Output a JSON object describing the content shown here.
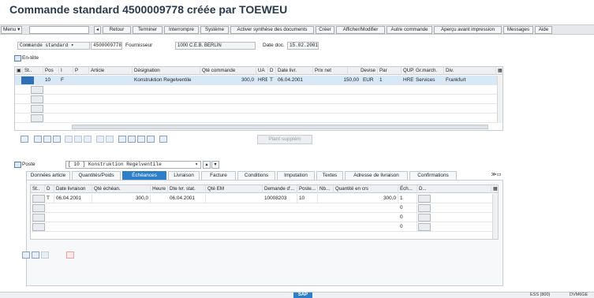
{
  "window": {
    "title": "Commande standard 4500009778 créée par TOEWEU"
  },
  "toolbar": {
    "menu_label": "Menu",
    "buttons": [
      "Retour",
      "Terminer",
      "Interrompre",
      "Système",
      "Activer synthèse des documents",
      "Créer",
      "Afficher/Modifier",
      "Autre commande",
      "Aperçu avant impression",
      "Messages",
      "Aide"
    ]
  },
  "header": {
    "order_type": "Commande standard",
    "order_number": "4500009778",
    "vendor_label": "Fournisseur",
    "vendor_value": "1000 C.E.B. BERLIN",
    "docdate_label": "Date doc.",
    "docdate_value": "15.02.2001",
    "entete_label": "En-tête"
  },
  "items_table": {
    "headers": [
      "St..",
      "Pos",
      "I",
      "P",
      "Article",
      "Désignation",
      "Qté commande",
      "UA",
      "D",
      "Date livr.",
      "Prix net",
      "Devise",
      "Par",
      "QUP",
      "Gr.march.",
      "Div."
    ],
    "rows": [
      {
        "st": "",
        "pos": "10",
        "i": "F",
        "p": "",
        "article": "",
        "designation": "Konstruktion Regelventile",
        "qty": "300,0",
        "ua": "HRE",
        "d": "T",
        "date": "06.04.2001",
        "price": "150,00",
        "currency": "EUR",
        "per": "1",
        "qup": "HRE",
        "group": "Services",
        "plant": "Frankfurt"
      }
    ],
    "plant_button": "Plant supplém"
  },
  "position": {
    "label": "Poste",
    "selector": "[ 10 ] Konstruktion Regelventile",
    "tabs": [
      "Données article",
      "Quantités/Poids",
      "Échéances",
      "Livraison",
      "Facture",
      "Conditions",
      "Imputation",
      "Textes",
      "Adresse de livraison",
      "Confirmations"
    ],
    "active_tab": "Échéances"
  },
  "schedule_table": {
    "headers": [
      "St..",
      "D",
      "Date livraison",
      "Qté échéan.",
      "Heure",
      "Dte lvr. stat.",
      "Qté EM",
      "Demande d'...",
      "Poste...",
      "Nb...",
      "Quantité en crs",
      "Éch...",
      "D..."
    ],
    "rows": [
      {
        "d": "T",
        "date": "06.04.2001",
        "qty": "300,0",
        "stat_date": "06.04.2001",
        "request": "10008203",
        "item": "10",
        "open_qty": "300,0",
        "sched": "1"
      },
      {
        "sched": "0"
      },
      {
        "sched": "0"
      },
      {
        "sched": "0"
      }
    ]
  },
  "statusbar": {
    "logo": "SAP",
    "session": "ESS (800)",
    "server": "DVM6GE"
  },
  "colors": {
    "accent": "#2f7fc8",
    "selected_row": "#d7e8f7",
    "title": "#2b3a4a"
  }
}
